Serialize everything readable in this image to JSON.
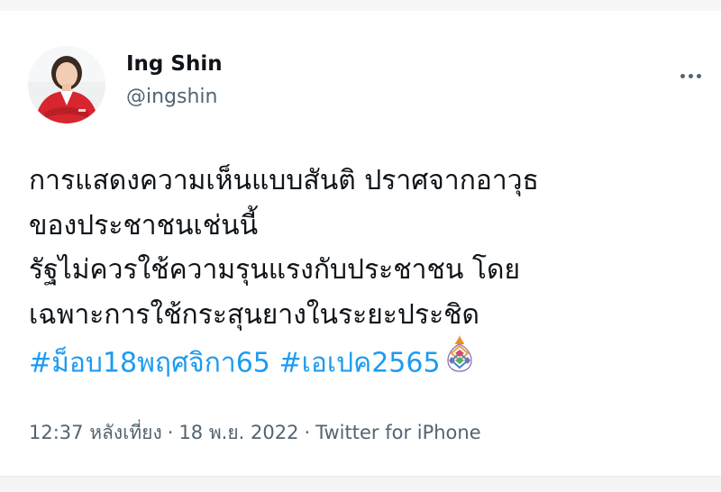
{
  "author": {
    "display_name": "Ing Shin",
    "handle": "@ingshin",
    "avatar_icon": "profile-photo-avatar"
  },
  "tweet": {
    "lines": [
      "การแสดงความเห็นแบบสันติ ปราศจากอาวุธ",
      "ของประชาชนเช่นนี้",
      "รัฐไม่ควรใช้ความรุนแรงกับประชาชน โดย",
      "เฉพาะการใช้กระสุนยางในระยะประชิด"
    ],
    "hashtags": [
      "#ม็อบ18พฤศจิกา65",
      "#เอเปค2565"
    ],
    "hashflag_icon": "apec-2022-hashflag-icon"
  },
  "meta": {
    "time": "12:37 หลังเที่ยง",
    "separator": "·",
    "date": "18 พ.ย. 2022",
    "source": "Twitter for iPhone"
  },
  "colors": {
    "text": "#0f1419",
    "secondary": "#536471",
    "link": "#1d9bf0",
    "avatar_jacket": "#d7262f"
  }
}
